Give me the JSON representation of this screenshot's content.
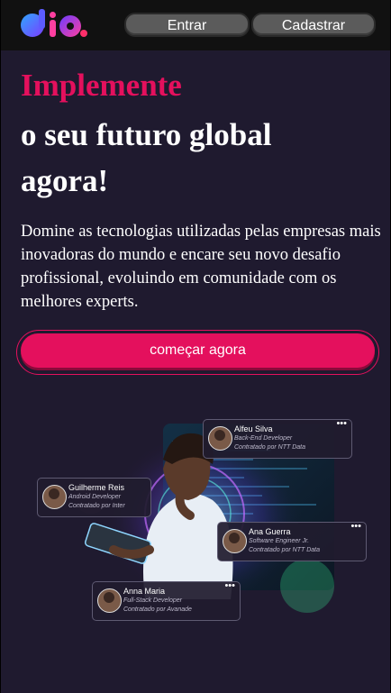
{
  "header": {
    "logo_text": "dio.",
    "login_label": "Entrar",
    "signup_label": "Cadastrar"
  },
  "hero": {
    "highlight": "Implemente",
    "title_rest": "o seu futuro global agora!",
    "description": "Domine as tecnologias utilizadas pelas empresas mais inovadoras do mundo e encare seu novo desafio profissional, evoluindo em comunidade com os melhores experts.",
    "cta_label": "começar agora"
  },
  "profiles": [
    {
      "name": "Alfeu Silva",
      "role": "Back-End Developer",
      "company": "Contratado por NTT Data"
    },
    {
      "name": "Guilherme Reis",
      "role": "Android Developer",
      "company": "Contratado por Inter"
    },
    {
      "name": "Ana Guerra",
      "role": "Software Engineer Jr.",
      "company": "Contratado por NTT Data"
    },
    {
      "name": "Anna Maria",
      "role": "Full-Stack Developer",
      "company": "Contratado por Avanade"
    }
  ],
  "colors": {
    "accent": "#e4105d",
    "background": "#1f1a2f",
    "header": "#111111"
  }
}
